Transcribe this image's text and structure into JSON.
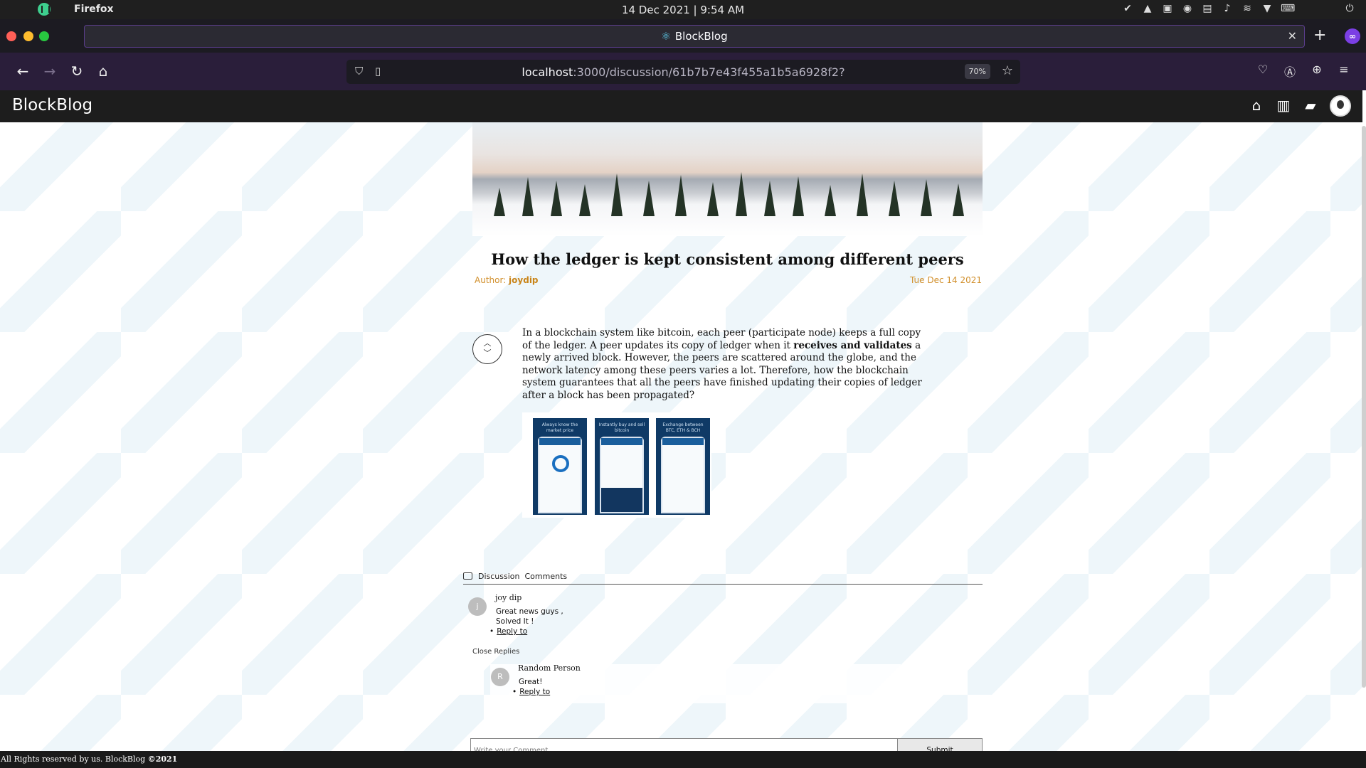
{
  "os": {
    "app_name": "Firefox",
    "clock": "14 Dec 2021 | 9:54 AM"
  },
  "browser": {
    "tab_title": "BlockBlog",
    "url_host": "localhost",
    "url_path": ":3000/discussion/61b7b7e43f455a1b5a6928f2?",
    "zoom": "70%"
  },
  "app": {
    "brand": "BlockBlog"
  },
  "post": {
    "title": "How the ledger is kept consistent among different peers",
    "author_label": "Author: ",
    "author": "joydip",
    "date": "Tue Dec 14 2021",
    "body_pre": "In a blockchain system like bitcoin, each peer (participate node) keeps a full copy of the ledger. A peer updates its copy of ledger when it ",
    "body_bold": "receives and validates",
    "body_post": " a newly arrived block. However, the peers are scattered around the globe, and the network latency among these peers varies a lot. Therefore, how the blockchain system guarantees that all the peers have finished updating their copies of ledger after a block has been propagated?",
    "image_captions": [
      "Always know the market price",
      "Instantly buy and sell bitcoin",
      "Exchange between BTC, ETH & BCH"
    ]
  },
  "discussion": {
    "header": "Discussion  Comments",
    "comments": [
      {
        "avatar_letter": "j",
        "author": "joy dip",
        "line1": "Great news guys ,",
        "line2": "Solved It !",
        "reply_label": "Reply to"
      }
    ],
    "close_replies": "Close Replies",
    "replies": [
      {
        "avatar_letter": "R",
        "author": "Random Person",
        "text": "Great!",
        "reply_label": "Reply to"
      }
    ],
    "input_placeholder": "Write your Comment",
    "submit_label": "Submit"
  },
  "footer": {
    "text": "All Rights reserved by us. BlockBlog ",
    "year": "©2021"
  }
}
